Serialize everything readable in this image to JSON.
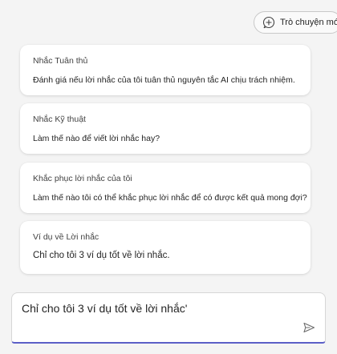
{
  "header": {
    "new_chat_label": "Trò chuyện mới",
    "new_chat_icon": "chat-add-icon"
  },
  "prompts": [
    {
      "title": "Nhắc Tuân thủ",
      "description": "Đánh giá nếu lời nhắc của tôi tuân thủ nguyên tắc AI chịu trách nhiệm."
    },
    {
      "title": "Nhắc Kỹ thuật",
      "description": "Làm thế nào để viết lời nhắc hay?"
    },
    {
      "title": "Khắc phục lời nhắc của tôi",
      "description": "Làm thế nào tôi có thể khắc phục lời nhắc để có được kết quả mong đợi?"
    },
    {
      "title": "Ví dụ về Lời nhắc",
      "description": "Chỉ cho tôi 3 ví dụ tốt về lời nhắc."
    }
  ],
  "composer": {
    "value": "Chỉ cho tôi 3 ví dụ tốt về lời nhắc'",
    "send_icon": "send-icon"
  },
  "colors": {
    "accent": "#5b5fc7",
    "background": "#f4f4f4",
    "card": "#ffffff"
  }
}
